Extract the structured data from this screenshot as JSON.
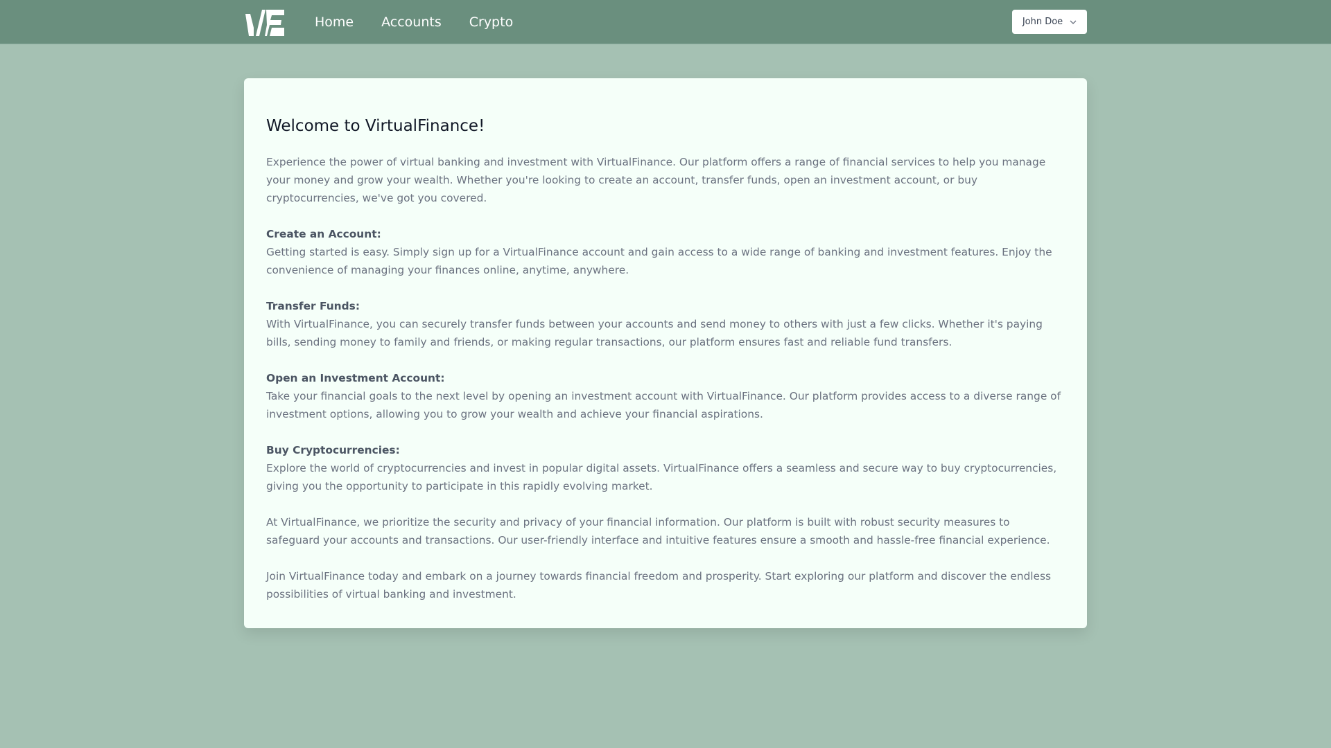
{
  "nav": {
    "brand_logo": "vf-logo-icon",
    "links": [
      "Home",
      "Accounts",
      "Crypto"
    ],
    "user": {
      "name": "John Doe",
      "icon": "chevron-down-icon"
    }
  },
  "colors": {
    "navbar_bg": "#6a8f7e",
    "page_bg": "#a5c1b3",
    "card_bg": "#f5fff9",
    "heading_text": "#111827",
    "body_text": "#6b7280"
  },
  "main": {
    "title": "Welcome to VirtualFinance!",
    "intro": "Experience the power of virtual banking and investment with VirtualFinance. Our platform offers a range of financial services to help you manage your money and grow your wealth. Whether you're looking to create an account, transfer funds, open an investment account, or buy cryptocurrencies, we've got you covered.",
    "sections": [
      {
        "title": "Create an Account:",
        "body": "Getting started is easy. Simply sign up for a VirtualFinance account and gain access to a wide range of banking and investment features. Enjoy the convenience of managing your finances online, anytime, anywhere."
      },
      {
        "title": "Transfer Funds:",
        "body": "With VirtualFinance, you can securely transfer funds between your accounts and send money to others with just a few clicks. Whether it's paying bills, sending money to family and friends, or making regular transactions, our platform ensures fast and reliable fund transfers."
      },
      {
        "title": "Open an Investment Account:",
        "body": "Take your financial goals to the next level by opening an investment account with VirtualFinance. Our platform provides access to a diverse range of investment options, allowing you to grow your wealth and achieve your financial aspirations."
      },
      {
        "title": "Buy Cryptocurrencies:",
        "body": "Explore the world of cryptocurrencies and invest in popular digital assets. VirtualFinance offers a seamless and secure way to buy cryptocurrencies, giving you the opportunity to participate in this rapidly evolving market."
      }
    ],
    "security": "At VirtualFinance, we prioritize the security and privacy of your financial information. Our platform is built with robust security measures to safeguard your accounts and transactions. Our user-friendly interface and intuitive features ensure a smooth and hassle-free financial experience.",
    "closing": "Join VirtualFinance today and embark on a journey towards financial freedom and prosperity. Start exploring our platform and discover the endless possibilities of virtual banking and investment."
  }
}
